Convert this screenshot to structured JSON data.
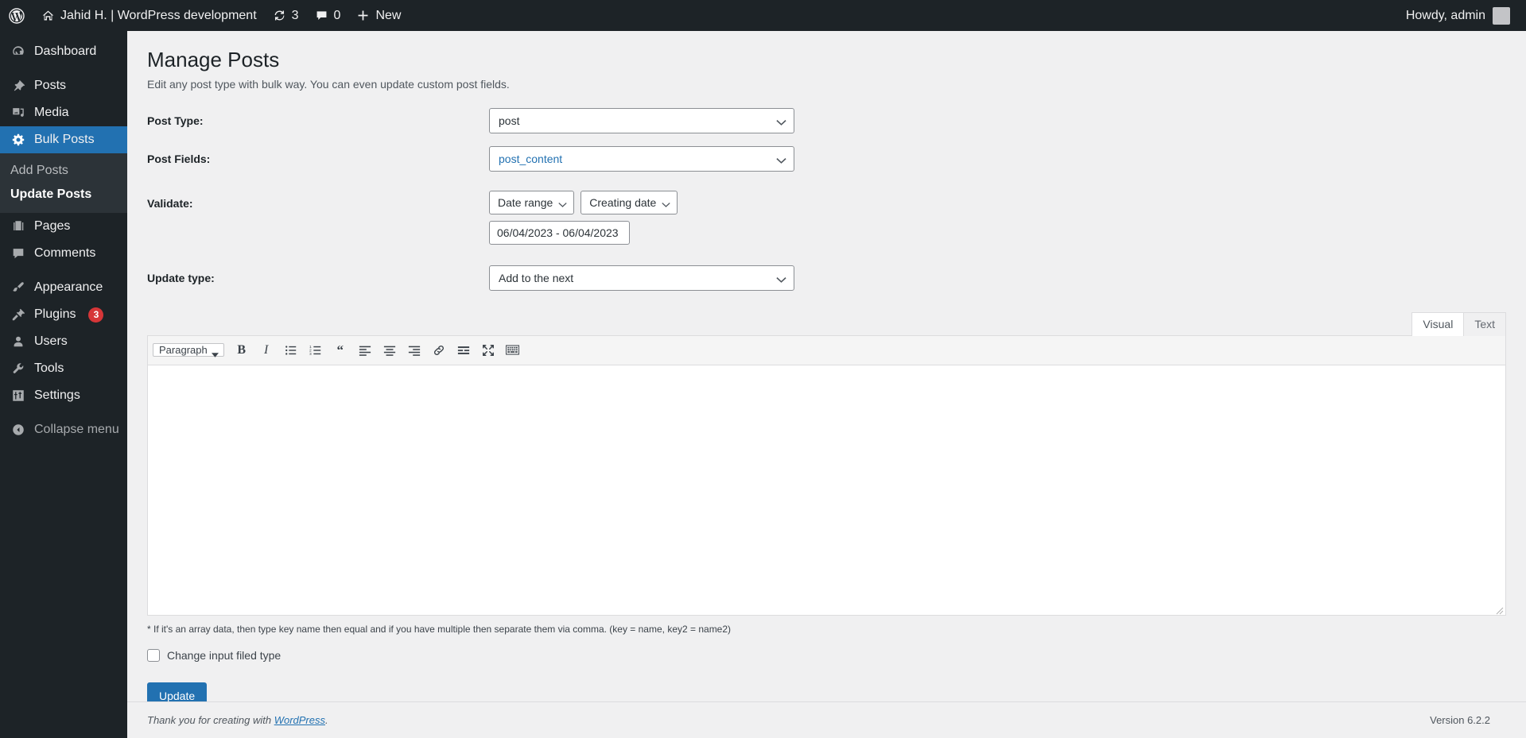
{
  "adminbar": {
    "logo_icon": "wordpress-logo-icon",
    "site_icon": "home-icon",
    "site_name": "Jahid H. | WordPress development",
    "updates_icon": "updates-icon",
    "updates_count": "3",
    "comments_icon": "comment-bubble-icon",
    "comments_count": "0",
    "new_icon": "plus-icon",
    "new_label": "New",
    "howdy": "Howdy, admin",
    "avatar": "avatar"
  },
  "sidebar": {
    "items": [
      {
        "label": "Dashboard",
        "icon": "dashboard-icon",
        "current": false
      },
      {
        "label": "Posts",
        "icon": "pin-icon",
        "current": false
      },
      {
        "label": "Media",
        "icon": "media-icon",
        "current": false
      },
      {
        "label": "Bulk Posts",
        "icon": "gear-icon",
        "current": true
      },
      {
        "label": "Pages",
        "icon": "pages-icon",
        "current": false
      },
      {
        "label": "Comments",
        "icon": "comment-bubble-icon",
        "current": false
      },
      {
        "label": "Appearance",
        "icon": "paintbrush-icon",
        "current": false
      },
      {
        "label": "Plugins",
        "icon": "plug-icon",
        "current": false,
        "badge": "3"
      },
      {
        "label": "Users",
        "icon": "user-icon",
        "current": false
      },
      {
        "label": "Tools",
        "icon": "wrench-icon",
        "current": false
      },
      {
        "label": "Settings",
        "icon": "sliders-icon",
        "current": false
      }
    ],
    "submenu": [
      {
        "label": "Add Posts",
        "current": false
      },
      {
        "label": "Update Posts",
        "current": true
      }
    ],
    "collapse": {
      "label": "Collapse menu",
      "icon": "collapse-arrow-icon"
    }
  },
  "page": {
    "title": "Manage Posts",
    "subtitle": "Edit any post type with bulk way. You can even update custom post fields."
  },
  "form": {
    "post_type": {
      "label": "Post Type:",
      "value": "post"
    },
    "post_fields": {
      "label": "Post Fields:",
      "value": "post_content"
    },
    "validate": {
      "label": "Validate:",
      "range_type": "Date range",
      "date_basis": "Creating date",
      "date_value": "06/04/2023 - 06/04/2023",
      "date_placeholder": "06/04/2023 - 06/04/2023"
    },
    "update_type": {
      "label": "Update type:",
      "value": "Add to the next"
    }
  },
  "editor": {
    "tabs": [
      {
        "label": "Visual",
        "active": true
      },
      {
        "label": "Text",
        "active": false
      }
    ],
    "format_select": "Paragraph",
    "toolbar": [
      {
        "name": "bold-icon",
        "glyph": "B"
      },
      {
        "name": "italic-icon",
        "glyph": "I"
      },
      {
        "name": "bulleted-list-icon",
        "glyph": ""
      },
      {
        "name": "numbered-list-icon",
        "glyph": ""
      },
      {
        "name": "blockquote-icon",
        "glyph": ""
      },
      {
        "name": "align-left-icon",
        "glyph": ""
      },
      {
        "name": "align-center-icon",
        "glyph": ""
      },
      {
        "name": "align-right-icon",
        "glyph": ""
      },
      {
        "name": "insert-link-icon",
        "glyph": ""
      },
      {
        "name": "read-more-icon",
        "glyph": ""
      },
      {
        "name": "fullscreen-icon",
        "glyph": ""
      },
      {
        "name": "keyboard-shortcuts-icon",
        "glyph": ""
      }
    ],
    "content": ""
  },
  "help_note": "* If it's an array data, then type key name then equal and if you have multiple then separate them via comma. (key = name, key2 = name2)",
  "checkbox": {
    "label": "Change input filed type",
    "checked": false
  },
  "submit": {
    "label": "Update"
  },
  "footer": {
    "thanks_prefix": "Thank you for creating with ",
    "link": "WordPress",
    "thanks_suffix": ".",
    "version": "Version 6.2.2"
  },
  "colors": {
    "admin_dark": "#1d2327",
    "admin_submenu": "#2c3338",
    "accent_blue": "#2271b1",
    "badge_red": "#d63638",
    "page_bg": "#f0f0f1"
  }
}
